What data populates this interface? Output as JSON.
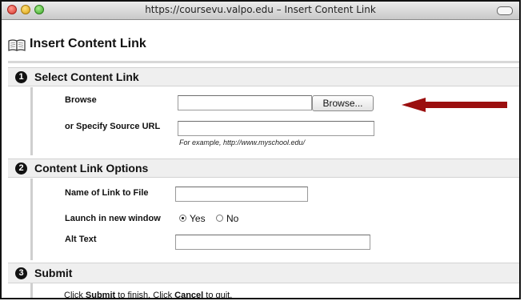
{
  "window": {
    "title": "https://coursevu.valpo.edu – Insert Content Link"
  },
  "page": {
    "title": "Insert Content Link"
  },
  "sections": [
    {
      "number": "1",
      "title": "Select Content Link"
    },
    {
      "number": "2",
      "title": "Content Link Options"
    },
    {
      "number": "3",
      "title": "Submit"
    }
  ],
  "select_content": {
    "browse_label": "Browse",
    "browse_button": "Browse...",
    "source_url_label": "or Specify Source URL",
    "source_url_hint": "For example, http://www.myschool.edu/"
  },
  "options": {
    "name_label": "Name of Link to File",
    "launch_label": "Launch in new window",
    "launch_yes": "Yes",
    "launch_no": "No",
    "launch_selected": "Yes",
    "alt_text_label": "Alt Text"
  },
  "submit": {
    "text_1": "Click ",
    "submit_word": "Submit",
    "text_2": " to finish. Click ",
    "cancel_word": "Cancel",
    "text_3": " to quit."
  },
  "annotation": {
    "arrow_color": "#9b0f0f"
  }
}
